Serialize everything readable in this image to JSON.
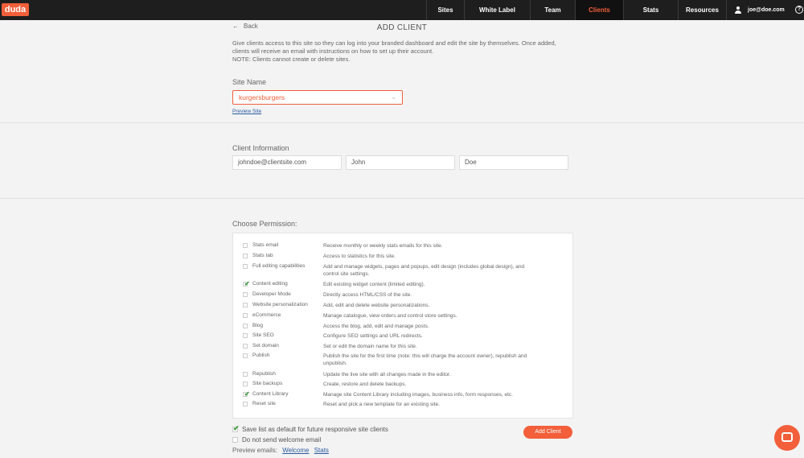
{
  "brand": {
    "logo": "duda",
    "accent": "#f25f3a"
  },
  "nav": {
    "items": [
      {
        "label": "Sites"
      },
      {
        "label": "White Label"
      },
      {
        "label": "Team"
      },
      {
        "label": "Clients",
        "active": true
      },
      {
        "label": "Stats"
      },
      {
        "label": "Resources"
      }
    ],
    "user": "joe@doe.com",
    "help": "?"
  },
  "page": {
    "back_label": "Back",
    "title": "ADD CLIENT",
    "description_1": "Give clients access to this site so they can log into your branded dashboard and edit the site by themselves. Once added,",
    "description_2": "clients will receive an email with instructions on how to set up their account.",
    "description_3": "NOTE: Clients cannot create or delete sites."
  },
  "site": {
    "label": "Site Name",
    "selected": "kurgersburgers",
    "preview_link": "Preview Site"
  },
  "client": {
    "label": "Client Information",
    "email": "johndoe@clientsite.com",
    "first_name": "John",
    "last_name": "Doe"
  },
  "permissions": {
    "label": "Choose Permission:",
    "items": [
      {
        "name": "Stats email",
        "desc": "Receive monthly or weekly stats emails for this site.",
        "checked": false
      },
      {
        "name": "Stats tab",
        "desc": "Access to statistics for this site.",
        "checked": false
      },
      {
        "name": "Full editing capabilities",
        "desc": "Add and manage widgets, pages and popups, edit design (includes global design), and",
        "desc2": "control site settings.",
        "checked": false
      },
      {
        "name": "Content editing",
        "desc": "Edit existing widget content (limited editing).",
        "checked": true
      },
      {
        "name": "Developer Mode",
        "desc": "Directly access HTML/CSS of the site.",
        "checked": false
      },
      {
        "name": "Website personalization",
        "desc": "Add, edit and delete website personalizations.",
        "checked": false
      },
      {
        "name": "eCommerce",
        "desc": "Manage catalogue, view orders and control store settings.",
        "checked": false
      },
      {
        "name": "Blog",
        "desc": "Access the blog, add, edit and manage posts.",
        "checked": false
      },
      {
        "name": "Site SEO",
        "desc": "Configure SEO settings and URL redirects.",
        "checked": false
      },
      {
        "name": "Set domain",
        "desc": "Set or edit the domain name for this site.",
        "checked": false
      },
      {
        "name": "Publish",
        "desc": "Publish the site for the first time (note: this will charge the account owner), republish and",
        "desc2": "unpublish.",
        "checked": false
      },
      {
        "name": "Republish",
        "desc": "Update the live site with all changes made in the editor.",
        "checked": false
      },
      {
        "name": "Site backups",
        "desc": "Create, restore and delete backups.",
        "checked": false
      },
      {
        "name": "Content Library",
        "desc": "Manage site Content Library including images, business info, form responses, etc.",
        "checked": true
      },
      {
        "name": "Reset site",
        "desc": "Reset and pick a new template for an existing site.",
        "checked": false
      }
    ]
  },
  "footer": {
    "save_default": "Save list as default for future responsive site clients",
    "save_default_checked": true,
    "no_welcome": "Do not send welcome email",
    "no_welcome_checked": false,
    "preview_label": "Preview emails:",
    "preview_welcome": "Welcome",
    "preview_stats": "Stats",
    "add_button": "Add Client"
  }
}
